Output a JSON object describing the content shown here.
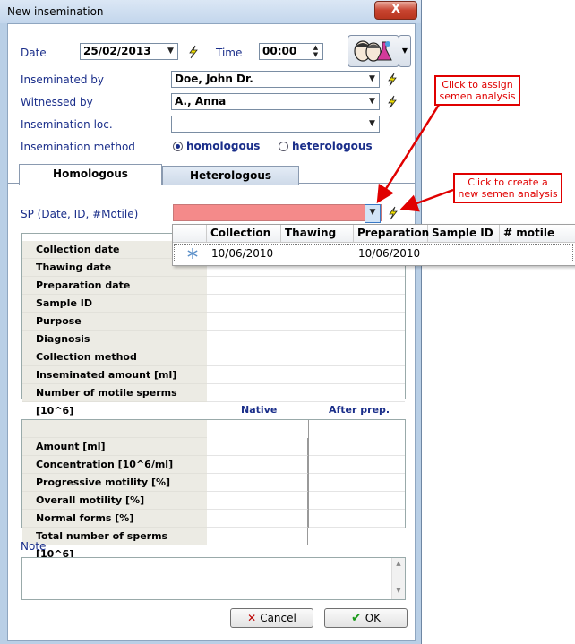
{
  "window": {
    "title": "New insemination",
    "close_label": "X"
  },
  "form": {
    "date_label": "Date",
    "date_value": "25/02/2013",
    "time_label": "Time",
    "time_value": "00:00",
    "inseminated_by_label": "Inseminated by",
    "inseminated_by_value": "Doe, John Dr.",
    "witnessed_by_label": "Witnessed by",
    "witnessed_by_value": "A., Anna",
    "location_label": "Insemination loc.",
    "location_value": "",
    "method_label": "Insemination method",
    "method_options": [
      "homologous",
      "heterologous"
    ],
    "method_selected": "homologous"
  },
  "tabs": [
    {
      "label": "Homologous",
      "active": true
    },
    {
      "label": "Heterologous",
      "active": false
    }
  ],
  "sp": {
    "label": "SP (Date, ID, #Motile)",
    "value": "",
    "highlight_color": "#f48a8a"
  },
  "sp_popup": {
    "columns": [
      "Collection",
      "Thawing",
      "Preparation",
      "Sample ID",
      "# motile"
    ],
    "rows": [
      {
        "collection": "10/06/2010",
        "thawing": "",
        "preparation": "10/06/2010",
        "sample_id": "",
        "motile": ""
      }
    ]
  },
  "details_rows": [
    "Collection date",
    "Thawing date",
    "Preparation date",
    "Sample ID",
    "Purpose",
    "Diagnosis",
    "Collection method",
    "Inseminated amount [ml]",
    "Number of motile sperms [10^6]"
  ],
  "analysis": {
    "col_native": "Native",
    "col_after": "After prep.",
    "rows": [
      "Amount [ml]",
      "Concentration [10^6/ml]",
      "Progressive motility [%]",
      "Overall motility [%]",
      "Normal forms [%]",
      "Total number of sperms [10^6]"
    ]
  },
  "note": {
    "label": "Note",
    "value": ""
  },
  "buttons": {
    "cancel": "Cancel",
    "ok": "OK"
  },
  "callouts": {
    "assign": "Click to assign semen analysis",
    "create": "Click to create a new semen analysis",
    "color": "#e00000"
  }
}
